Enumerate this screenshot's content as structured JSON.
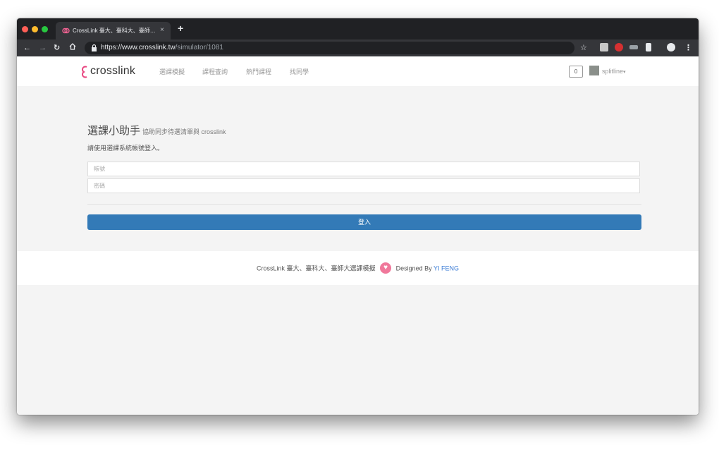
{
  "browser": {
    "tab_title": "CrossLink 臺大、臺科大、臺師…",
    "tab_close": "×",
    "new_tab": "+",
    "url_host": "https://www.crosslink.tw",
    "url_path": "/simulator/1081",
    "icons": [
      "back-icon",
      "forward-icon",
      "reload-icon",
      "home-icon",
      "lock-icon",
      "star-icon",
      "extension-icon",
      "profile-icon",
      "menu-icon"
    ]
  },
  "navbar": {
    "brand": "crosslink",
    "links": [
      "選課模擬",
      "課程查詢",
      "熱門課程",
      "找同學"
    ],
    "notification_count": "0",
    "username": "splitline",
    "caret": "▾"
  },
  "main": {
    "title": "選課小助手",
    "title_sub": "協助同步待選清單與 crosslink",
    "instruction": "請使用選課系統帳號登入。",
    "account_placeholder": "帳號",
    "password_placeholder": "密碼",
    "login_label": "登入"
  },
  "footer": {
    "text": "CrossLink 臺大、臺科大、臺師大選課模擬",
    "designed_by": "Designed By",
    "author": "YI FENG"
  },
  "colors": {
    "brand_pink": "#e8457f",
    "primary_button": "#337ab7",
    "author_link": "#3a7bd5"
  }
}
